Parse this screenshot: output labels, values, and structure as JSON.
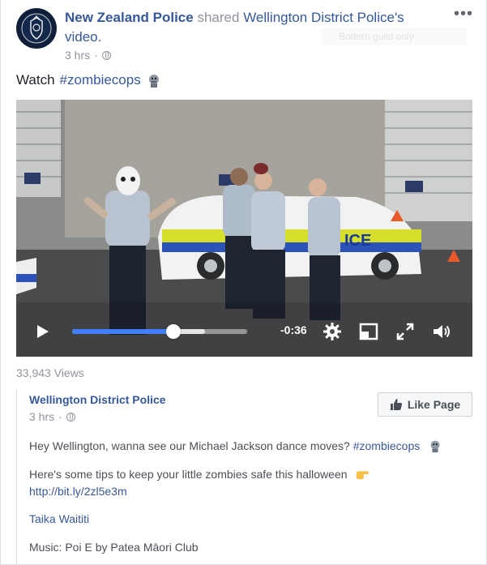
{
  "post": {
    "page_name": "New Zealand Police",
    "shared_text": "shared",
    "shared_source": "Wellington District Police's video.",
    "time": "3 hrs",
    "separator": "·",
    "more_label": "•••",
    "status_prefix": "Watch",
    "status_hashtag": "#zombiecops",
    "ghost_label": "Bottern guild only"
  },
  "video": {
    "time_remaining": "-0:36",
    "progress": 0.58,
    "buffered": 0.76,
    "views": "33,943 Views",
    "scene_sign_text": "ICE"
  },
  "quoted_post": {
    "page_name": "Wellington District Police",
    "time": "3 hrs",
    "separator": "·",
    "like_page_label": "Like Page",
    "line1_text": "Hey Wellington, wanna see our Michael Jackson dance moves?",
    "line1_hashtag": "#zombiecops",
    "line2_text": "Here's some tips to keep your little zombies safe this halloween",
    "link": "http://bit.ly/2zl5e3m",
    "credit": "Taika Waititi",
    "music": "Music: Poi E by Patea Māori Club"
  },
  "colors": {
    "link_blue": "#365899",
    "meta_grey": "#90949c",
    "progress_blue": "#4080ff"
  }
}
